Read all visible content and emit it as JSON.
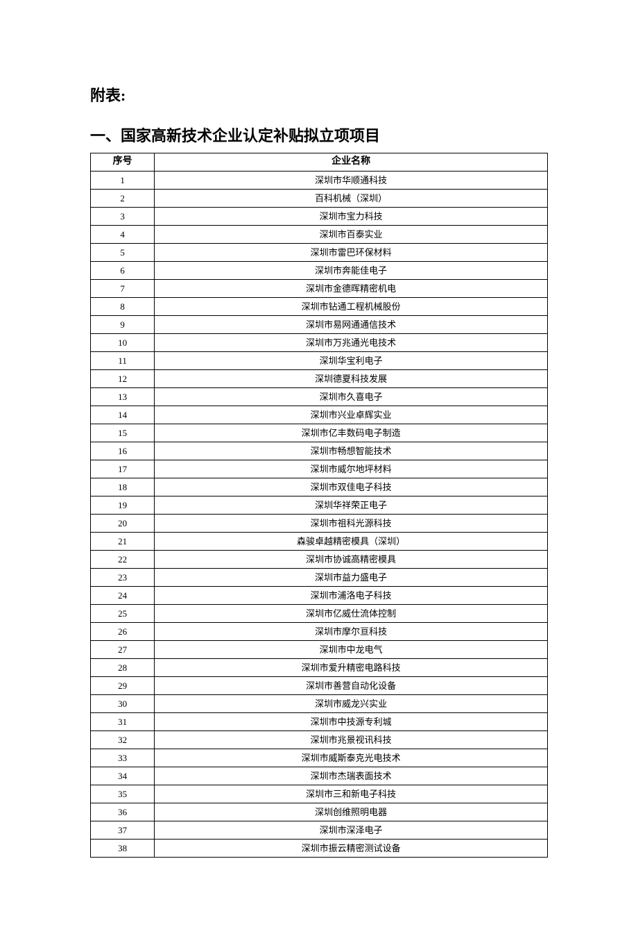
{
  "attachment_label": "附表:",
  "section_heading": "一、国家高新技术企业认定补贴拟立项项目",
  "table_headers": {
    "index": "序号",
    "company": "企业名称"
  },
  "rows": [
    {
      "index": "1",
      "company": "深圳市华顺通科技"
    },
    {
      "index": "2",
      "company": "百科机械（深圳）"
    },
    {
      "index": "3",
      "company": "深圳市宝力科技"
    },
    {
      "index": "4",
      "company": "深圳市百泰实业"
    },
    {
      "index": "5",
      "company": "深圳市雷巴环保材料"
    },
    {
      "index": "6",
      "company": "深圳市奔能佳电子"
    },
    {
      "index": "7",
      "company": "深圳市金德晖精密机电"
    },
    {
      "index": "8",
      "company": "深圳市钻通工程机械股份"
    },
    {
      "index": "9",
      "company": "深圳市易网通通信技术"
    },
    {
      "index": "10",
      "company": "深圳市万兆通光电技术"
    },
    {
      "index": "11",
      "company": "深圳华宝利电子"
    },
    {
      "index": "12",
      "company": "深圳德夏科技发展"
    },
    {
      "index": "13",
      "company": "深圳市久喜电子"
    },
    {
      "index": "14",
      "company": "深圳市兴业卓辉实业"
    },
    {
      "index": "15",
      "company": "深圳市亿丰数码电子制造"
    },
    {
      "index": "16",
      "company": "深圳市畅想智能技术"
    },
    {
      "index": "17",
      "company": "深圳市威尔地坪材料"
    },
    {
      "index": "18",
      "company": "深圳市双佳电子科技"
    },
    {
      "index": "19",
      "company": "深圳华祥荣正电子"
    },
    {
      "index": "20",
      "company": "深圳市祖科光源科技"
    },
    {
      "index": "21",
      "company": "森骏卓越精密模具（深圳）"
    },
    {
      "index": "22",
      "company": "深圳市协诚高精密模具"
    },
    {
      "index": "23",
      "company": "深圳市益力盛电子"
    },
    {
      "index": "24",
      "company": "深圳市浦洛电子科技"
    },
    {
      "index": "25",
      "company": "深圳市亿威仕流体控制"
    },
    {
      "index": "26",
      "company": "深圳市摩尔亘科技"
    },
    {
      "index": "27",
      "company": "深圳市中龙电气"
    },
    {
      "index": "28",
      "company": "深圳市爱升精密电路科技"
    },
    {
      "index": "29",
      "company": "深圳市善营自动化设备"
    },
    {
      "index": "30",
      "company": "深圳市威龙兴实业"
    },
    {
      "index": "31",
      "company": "深圳市中技源专利城"
    },
    {
      "index": "32",
      "company": "深圳市兆景视讯科技"
    },
    {
      "index": "33",
      "company": "深圳市威斯泰克光电技术"
    },
    {
      "index": "34",
      "company": "深圳市杰瑞表面技术"
    },
    {
      "index": "35",
      "company": "深圳市三和新电子科技"
    },
    {
      "index": "36",
      "company": "深圳创维照明电器"
    },
    {
      "index": "37",
      "company": "深圳市深泽电子"
    },
    {
      "index": "38",
      "company": "深圳市振云精密测试设备"
    }
  ]
}
